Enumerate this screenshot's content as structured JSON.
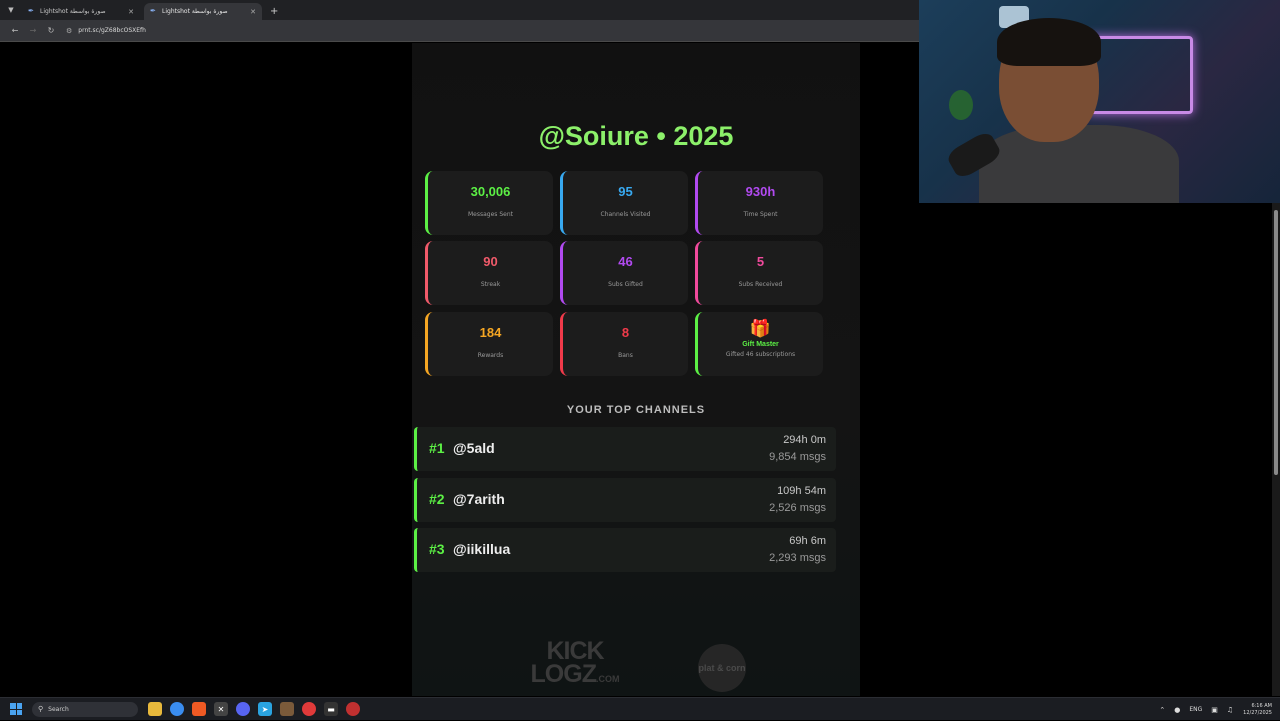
{
  "browser": {
    "tabs": [
      {
        "label": "Lightshot صورة بواسطة",
        "active": false
      },
      {
        "label": "Lightshot صورة بواسطة",
        "active": true
      }
    ],
    "url": "prnt.sc/gZ68bcOSXEfh"
  },
  "profile": {
    "title": "@Soiure • 2025"
  },
  "stats": [
    {
      "value": "30,006",
      "label": "Messages Sent",
      "color": "#5cf045"
    },
    {
      "value": "95",
      "label": "Channels Visited",
      "color": "#38a9f0"
    },
    {
      "value": "930h",
      "label": "Time Spent",
      "color": "#b14af0"
    },
    {
      "value": "90",
      "label": "Streak",
      "color": "#f05a6a"
    },
    {
      "value": "46",
      "label": "Subs Gifted",
      "color": "#b14af0"
    },
    {
      "value": "5",
      "label": "Subs Received",
      "color": "#f04a9c"
    },
    {
      "value": "184",
      "label": "Rewards",
      "color": "#f5a623"
    },
    {
      "value": "8",
      "label": "Bans",
      "color": "#f03a4a"
    }
  ],
  "badge": {
    "icon": "gift-icon",
    "title": "Gift Master",
    "subtitle": "Gifted 46 subscriptions",
    "color": "#5cf045"
  },
  "top_channels": {
    "heading": "YOUR TOP CHANNELS",
    "items": [
      {
        "rank": "#1",
        "name": "@5ald",
        "time": "294h 0m",
        "msgs": "9,854 msgs"
      },
      {
        "rank": "#2",
        "name": "@7arith",
        "time": "109h 54m",
        "msgs": "2,526 msgs"
      },
      {
        "rank": "#3",
        "name": "@iikillua",
        "time": "69h 6m",
        "msgs": "2,293 msgs"
      }
    ]
  },
  "footer_logos": {
    "kick_line1": "KICK",
    "kick_line2": "LOGZ",
    "kick_suffix": ".COM",
    "circle_logo": "plat & corn"
  },
  "taskbar": {
    "search_label": "Search",
    "language": "ENG",
    "time": "6:16 AM",
    "date": "12/27/2025"
  }
}
